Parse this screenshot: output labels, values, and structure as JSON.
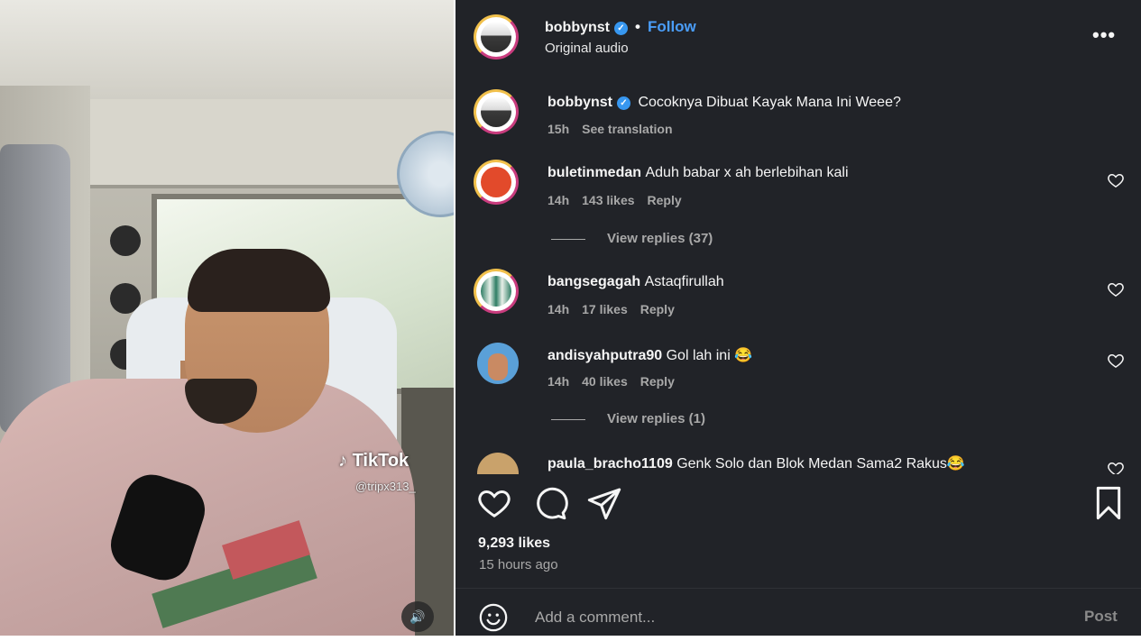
{
  "media": {
    "watermark": "TikTok",
    "handle": "@tripx313_",
    "mute_icon": "speaker-icon"
  },
  "post": {
    "author": "bobbynst",
    "follow_label": "Follow",
    "audio": "Original audio",
    "more_icon": "more-icon",
    "likes": "9,293 likes",
    "posted": "15 hours ago"
  },
  "caption": {
    "username": "bobbynst",
    "text": "Cocoknya Dibuat Kayak Mana Ini Weee?",
    "time": "15h",
    "see_translation": "See translation"
  },
  "comments": [
    {
      "username": "buletinmedan",
      "text": "Aduh babar x ah berlebihan kali",
      "time": "14h",
      "likes": "143 likes",
      "reply": "Reply",
      "view_replies": "View replies (37)"
    },
    {
      "username": "bangsegagah",
      "text": "Astaqfirullah",
      "time": "14h",
      "likes": "17 likes",
      "reply": "Reply"
    },
    {
      "username": "andisyahputra90",
      "text": "Gol lah ini 😂",
      "time": "14h",
      "likes": "40 likes",
      "reply": "Reply",
      "view_replies": "View replies (1)"
    },
    {
      "username": "paula_bracho1109",
      "text": "Genk Solo dan Blok Medan Sama2 Rakus😂"
    }
  ],
  "composer": {
    "placeholder": "Add a comment...",
    "post_label": "Post"
  },
  "colors": {
    "panel_bg": "#212328",
    "link_blue": "#4a9df8",
    "verified_blue": "#3797f0",
    "muted_text": "#a8a8a8"
  }
}
